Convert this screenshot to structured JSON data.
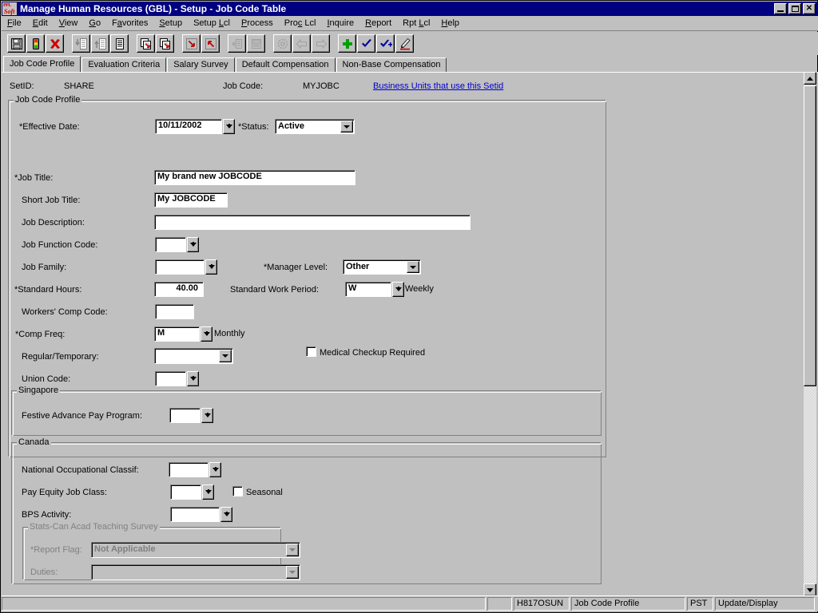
{
  "window": {
    "title": "Manage Human Resources (GBL) - Setup - Job Code Table",
    "icon": "peoplesoft-logo-icon",
    "minimize_label": "_",
    "maximize_label": "❐",
    "close_label": "✕"
  },
  "menu": [
    {
      "label": "File",
      "accel": "F"
    },
    {
      "label": "Edit",
      "accel": "E"
    },
    {
      "label": "View",
      "accel": "V"
    },
    {
      "label": "Go",
      "accel": "G"
    },
    {
      "label": "Favorites",
      "accel": "a"
    },
    {
      "label": "Setup",
      "accel": "S"
    },
    {
      "label": "Setup Lcl",
      "accel": "L"
    },
    {
      "label": "Process",
      "accel": "P"
    },
    {
      "label": "Proc Lcl",
      "accel": "c"
    },
    {
      "label": "Inquire",
      "accel": "I"
    },
    {
      "label": "Report",
      "accel": "R"
    },
    {
      "label": "Rpt Lcl",
      "accel": "L"
    },
    {
      "label": "Help",
      "accel": "H"
    }
  ],
  "toolbar": [
    {
      "name": "save-icon",
      "tip": "Save"
    },
    {
      "name": "traffic-light-icon",
      "tip": "Run"
    },
    {
      "name": "delete-red-x-icon",
      "tip": "Delete"
    },
    {
      "name": "insert-row-below-icon",
      "tip": "Insert Row"
    },
    {
      "name": "insert-row-above-icon",
      "tip": "Insert Row Above"
    },
    {
      "name": "list-rows-icon",
      "tip": "Update/Display All"
    },
    {
      "name": "next-in-list-icon",
      "tip": "Next in List"
    },
    {
      "name": "previous-in-list-icon",
      "tip": "Previous in List"
    },
    {
      "name": "arrow-down-right-icon",
      "tip": "Next Panel"
    },
    {
      "name": "arrow-up-left-icon",
      "tip": "Previous Panel"
    },
    {
      "name": "panel-left-icon",
      "tip": "First Panel"
    },
    {
      "name": "panel-grid-icon",
      "tip": "Panel Group"
    },
    {
      "name": "gear-icon",
      "tip": "Process"
    },
    {
      "name": "back-arrow-icon",
      "tip": "Back"
    },
    {
      "name": "forward-arrow-icon",
      "tip": "Forward"
    },
    {
      "name": "add-green-plus-icon",
      "tip": "Add"
    },
    {
      "name": "update-display-check-icon",
      "tip": "Update/Display"
    },
    {
      "name": "include-history-check-icon",
      "tip": "Include History"
    },
    {
      "name": "correct-history-pencil-icon",
      "tip": "Correct History"
    }
  ],
  "tabs": [
    {
      "label": "Job Code Profile",
      "active": true
    },
    {
      "label": "Evaluation Criteria",
      "active": false
    },
    {
      "label": "Salary Survey",
      "active": false
    },
    {
      "label": "Default Compensation",
      "active": false
    },
    {
      "label": "Non-Base Compensation",
      "active": false
    }
  ],
  "keys": {
    "setid_label": "SetID:",
    "setid_value": "SHARE",
    "jobcode_label": "Job Code:",
    "jobcode_value": "MYJOBC",
    "business_units_link": "Business Units that use this Setid",
    "link_color": "#0000cc"
  },
  "job_code_profile": {
    "group_title": "Job Code Profile",
    "effective_date_label": "*Effective Date:",
    "effective_date_value": "10/11/2002",
    "status_label": "*Status:",
    "status_value": "Active",
    "job_title_label": "*Job Title:",
    "job_title_value": "My brand new JOBCODE",
    "short_job_title_label": "Short Job Title:",
    "short_job_title_value": "My JOBCODE",
    "job_description_label": "Job Description:",
    "job_description_value": "",
    "job_function_code_label": "Job Function Code:",
    "job_function_code_value": "",
    "job_family_label": "Job Family:",
    "job_family_value": "",
    "manager_level_label": "*Manager Level:",
    "manager_level_value": "Other",
    "standard_hours_label": "*Standard Hours:",
    "standard_hours_value": "40.00",
    "standard_work_period_label": "Standard Work Period:",
    "standard_work_period_value": "W",
    "standard_work_period_desc": "Weekly",
    "workers_comp_code_label": "Workers' Comp Code:",
    "workers_comp_code_value": "",
    "comp_freq_label": "*Comp Freq:",
    "comp_freq_value": "M",
    "comp_freq_desc": "Monthly",
    "regular_temporary_label": "Regular/Temporary:",
    "regular_temporary_value": "",
    "medical_checkup_label": "Medical Checkup Required",
    "medical_checkup_checked": false,
    "union_code_label": "Union Code:",
    "union_code_value": ""
  },
  "singapore": {
    "group_title": "Singapore",
    "festive_advance_label": "Festive Advance Pay Program:",
    "festive_advance_value": ""
  },
  "canada": {
    "group_title": "Canada",
    "noc_label": "National Occupational Classif:",
    "noc_value": "",
    "pay_equity_label": "Pay Equity Job Class:",
    "pay_equity_value": "",
    "seasonal_label": "Seasonal",
    "seasonal_checked": false,
    "bps_activity_label": "BPS Activity:",
    "bps_activity_value": "",
    "stats_can": {
      "group_title": "Stats-Can Acad Teaching Survey",
      "report_flag_label": "*Report Flag:",
      "report_flag_value": "Not Applicable",
      "duties_label": "Duties:",
      "duties_value": ""
    }
  },
  "scrollbar": {
    "up_arrow": "▲",
    "down_arrow": "▼"
  },
  "statusbar": {
    "pane1": "",
    "pane2": "H817OSUN",
    "pane3": "Job Code Profile",
    "pane4": "PST",
    "pane5": "Update/Display"
  }
}
